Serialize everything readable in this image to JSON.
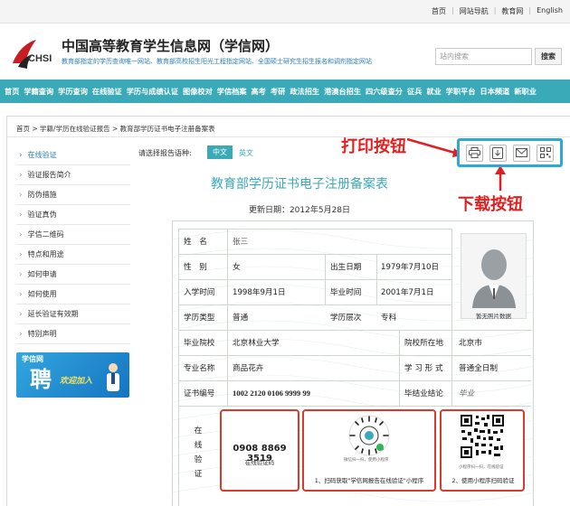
{
  "topbar": {
    "links": [
      "首页",
      "网站导航",
      "教育网",
      "English"
    ]
  },
  "header": {
    "logo_text": "CHSI",
    "title": "中国高等教育学生信息网（学信网）",
    "subtitle": "教育部指定的学历查询唯一网站、教育部高校招生阳光工程指定网站、全国硕士研究生招生报名和调剂指定网站",
    "search_placeholder": "站内搜索",
    "search_button": "搜索"
  },
  "nav": [
    "首页",
    "学籍查询",
    "学历查询",
    "在线验证",
    "学历与成绩认证",
    "图像校对",
    "学信档案",
    "高考",
    "考研",
    "政法招生",
    "港澳台招生",
    "四六级查分",
    "征兵",
    "就业",
    "学职平台",
    "日本频道",
    "新职业"
  ],
  "breadcrumb": "首页 > 学籍/学历在线验证报告 > 教育部学历证书电子注册备案表",
  "sidebar": {
    "items": [
      "在线验证",
      "验证报告简介",
      "防伪措施",
      "验证真伪",
      "学信二维码",
      "特点和用途",
      "如何申请",
      "如何使用",
      "延长验证有效期",
      "特别声明"
    ],
    "active_index": 0,
    "banner": {
      "brand": "学信网",
      "big": "聘",
      "slogan": "欢迎加入"
    }
  },
  "language": {
    "label": "请选择报告语种:",
    "cn": "中文",
    "en": "英文"
  },
  "annotations": {
    "print": "打印按钮",
    "download": "下载按钮"
  },
  "document": {
    "title": "教育部学历证书电子注册备案表",
    "update_date": "更新日期：2012年5月28日",
    "fields": {
      "name_label": "姓　名",
      "name_value": "张三",
      "gender_label": "性　别",
      "gender_value": "女",
      "birth_label": "出生日期",
      "birth_value": "1979年7月10日",
      "enroll_label": "入学时间",
      "enroll_value": "1998年9月1日",
      "grad_label": "毕业时间",
      "grad_value": "2001年7月1日",
      "edu_type_label": "学历类型",
      "edu_type_value": "普通",
      "edu_level_label": "学历层次",
      "edu_level_value": "专科",
      "school_label": "毕业院校",
      "school_value": "北京林业大学",
      "location_label": "院校所在地",
      "location_value": "北京市",
      "major_label": "专业名称",
      "major_value": "商品花卉",
      "form_label": "学 习 形 式",
      "form_value": "普通全日制",
      "cert_label": "证书编号",
      "cert_value": "1002 2120 0106 9999 99",
      "conclusion_label": "毕结业结论",
      "conclusion_value": "毕业"
    },
    "photo_caption": "暂无照片数据",
    "verify": {
      "label": "在线验证",
      "code": "0908 8869 3519",
      "code_caption": "在线验证码",
      "qr1_tiny": "微信扫一扫，使用小程序",
      "qr1_caption": "1、扫码获取\"学信网报告在线验证\"小程序",
      "qr2_tiny": "小程序扫一扫，在线验证",
      "qr2_caption": "2、使用小程序扫码验证"
    }
  },
  "colors": {
    "teal": "#3aa9b8",
    "link_blue": "#2a7fc1",
    "annotation_red": "#e02020",
    "box_red": "#d93a2c",
    "toolbar_border": "#2da9d8"
  }
}
